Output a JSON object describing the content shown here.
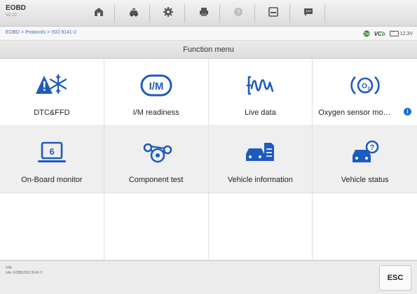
{
  "app": {
    "title": "EOBD",
    "version": "V2.10"
  },
  "toolbar": {
    "buttons": [
      {
        "name": "home-icon"
      },
      {
        "name": "vehicle-icon"
      },
      {
        "name": "settings-icon"
      },
      {
        "name": "print-icon"
      },
      {
        "name": "help-icon"
      },
      {
        "name": "save-icon"
      },
      {
        "name": "message-icon"
      }
    ]
  },
  "breadcrumb": {
    "items": [
      "EOBD",
      "Protocols",
      "ISO 9141-2"
    ],
    "separator": ">"
  },
  "status": {
    "vci": "VC",
    "vci_suffix": "b",
    "voltage": "12.3V"
  },
  "menu": {
    "title": "Function menu",
    "items": [
      {
        "label": "DTC&FFD",
        "icon": "dtc-warning-snowflake-icon"
      },
      {
        "label": "I/M readiness",
        "icon": "im-readiness-icon"
      },
      {
        "label": "Live data",
        "icon": "live-data-waveform-icon"
      },
      {
        "label": "Oxygen sensor mo…",
        "icon": "oxygen-sensor-icon"
      },
      {
        "label": "On-Board monitor",
        "icon": "onboard-monitor-icon"
      },
      {
        "label": "Component test",
        "icon": "component-test-icon"
      },
      {
        "label": "Vehicle information",
        "icon": "vehicle-information-icon"
      },
      {
        "label": "Vehicle status",
        "icon": "vehicle-status-icon"
      }
    ]
  },
  "footer": {
    "vin_label": "VIN:",
    "info_label": "Info: EOBD/ISO 9141-2",
    "esc_label": "ESC"
  },
  "colors": {
    "accent": "#1e6fd9",
    "icon": "#1e5bbf"
  }
}
